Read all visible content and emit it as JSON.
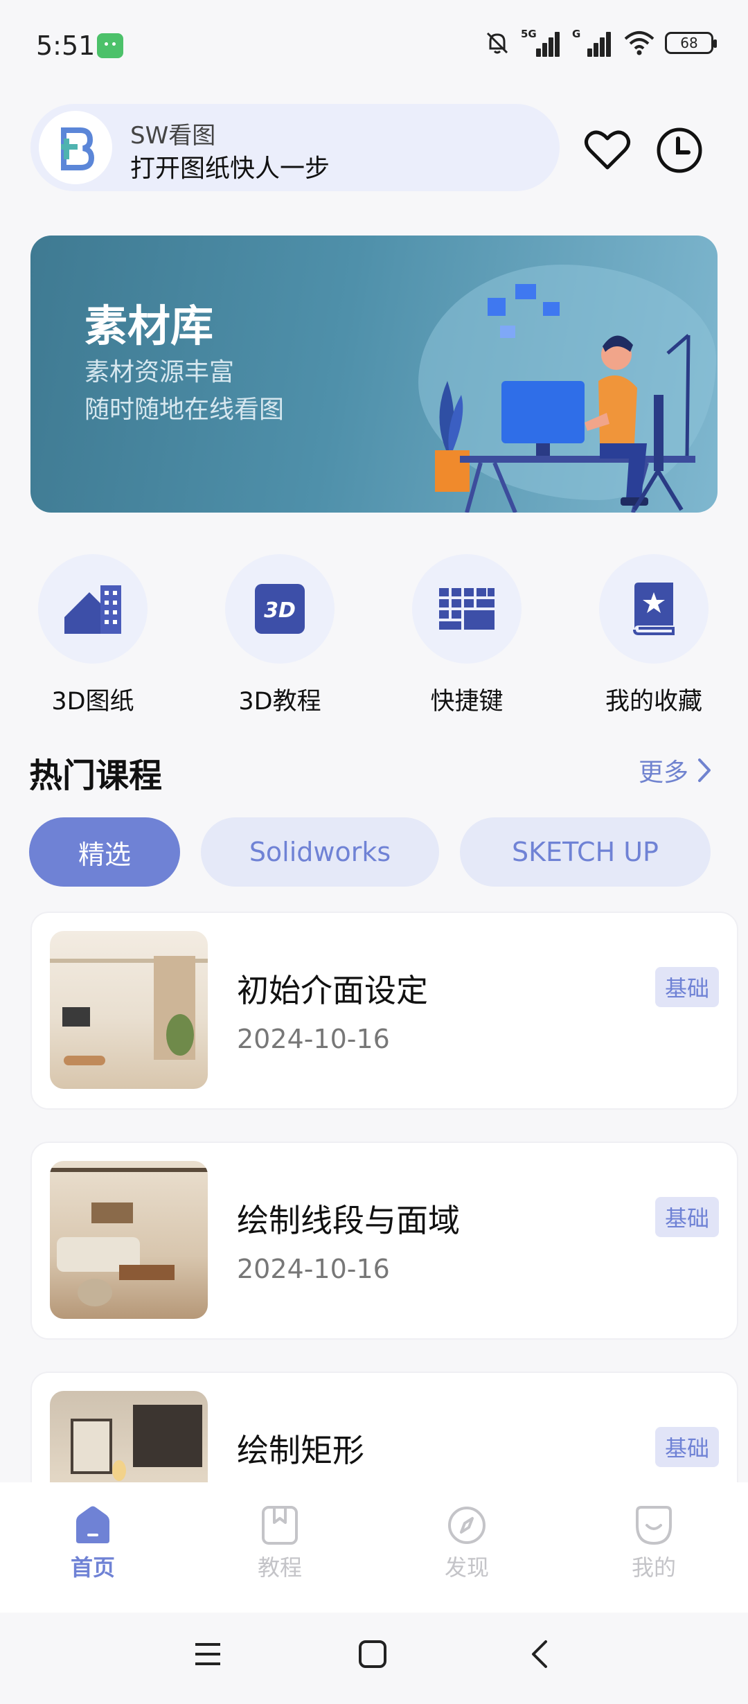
{
  "status_bar": {
    "time": "5:51",
    "net1": "5G",
    "net2": "G",
    "battery": "68"
  },
  "header": {
    "app_name": "SW看图",
    "slogan": "打开图纸快人一步",
    "favorite_icon": "heart-icon",
    "history_icon": "clock-icon"
  },
  "banner": {
    "title": "素材库",
    "line1": "素材资源丰富",
    "line2": "随时随地在线看图"
  },
  "quick_entries": [
    {
      "label": "3D图纸",
      "icon": "drawing-blocks-icon"
    },
    {
      "label": "3D教程",
      "icon": "3d-icon",
      "icon_text": "3D"
    },
    {
      "label": "快捷键",
      "icon": "keyboard-icon"
    },
    {
      "label": "我的收藏",
      "icon": "star-book-icon"
    }
  ],
  "section": {
    "title": "热门课程",
    "more": "更多"
  },
  "filters": [
    {
      "label": "精选",
      "active": true
    },
    {
      "label": "Solidworks",
      "active": false
    },
    {
      "label": "SKETCH UP",
      "active": false
    }
  ],
  "courses": [
    {
      "title": "初始介面设定",
      "date": "2024-10-16",
      "badge": "基础"
    },
    {
      "title": "绘制线段与面域",
      "date": "2024-10-16",
      "badge": "基础"
    },
    {
      "title": "绘制矩形",
      "date": "",
      "badge": "基础"
    }
  ],
  "bottom_nav": [
    {
      "label": "首页",
      "icon": "home-icon",
      "active": true
    },
    {
      "label": "教程",
      "icon": "bookmark-book-icon",
      "active": false
    },
    {
      "label": "发现",
      "icon": "compass-icon",
      "active": false
    },
    {
      "label": "我的",
      "icon": "profile-face-icon",
      "active": false
    }
  ],
  "colors": {
    "accent": "#6f82d5",
    "accent_light": "#e5e9f8",
    "banner": "#4f90aa",
    "background": "#f7f7f9"
  }
}
